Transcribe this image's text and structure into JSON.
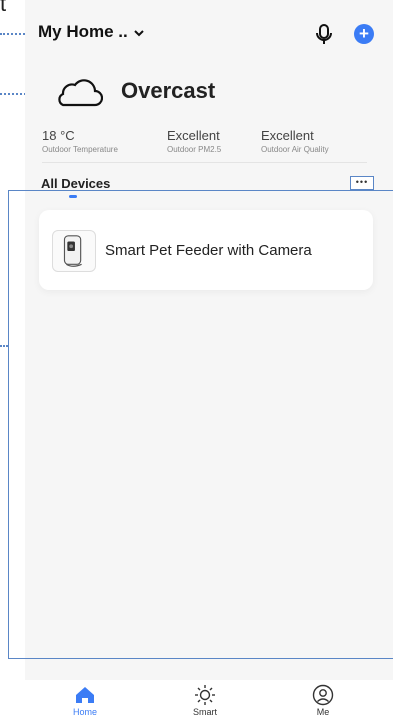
{
  "cropped_text": "t",
  "header": {
    "home_name": "My Home ..",
    "chevron": "⌄"
  },
  "actions": {
    "mic_icon": "microphone-icon",
    "add_icon": "plus-icon",
    "add_symbol": "+"
  },
  "weather": {
    "icon": "cloud-icon",
    "condition": "Overcast"
  },
  "stats": [
    {
      "value": "18 °C",
      "label": "Outdoor Temperature"
    },
    {
      "value": "Excellent",
      "label": "Outdoor PM2.5"
    },
    {
      "value": "Excellent",
      "label": "Outdoor Air Quality"
    }
  ],
  "section": {
    "title": "All Devices",
    "more_label": "•••"
  },
  "devices": [
    {
      "name": "Smart Pet Feeder with Camera",
      "icon": "pet-feeder-icon"
    }
  ],
  "nav": [
    {
      "label": "Home",
      "icon": "home-icon",
      "active": true
    },
    {
      "label": "Smart",
      "icon": "sun-icon",
      "active": false
    },
    {
      "label": "Me",
      "icon": "user-icon",
      "active": false
    }
  ],
  "colors": {
    "accent": "#3b7cf5",
    "annotation": "#5a86c6",
    "background": "#f6f6f6"
  }
}
